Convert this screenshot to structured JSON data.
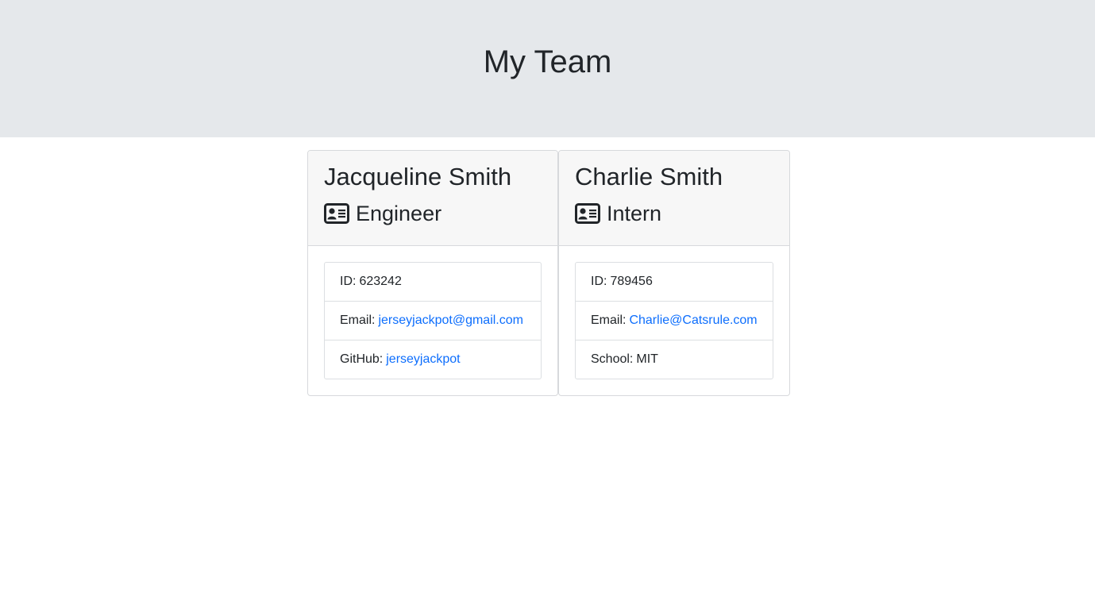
{
  "header": {
    "title": "My Team"
  },
  "employees": [
    {
      "name": "Jacqueline Smith",
      "role": "Engineer",
      "role_icon": "id-card-icon",
      "id_label": "ID:",
      "id": "623242",
      "email_label": "Email:",
      "email": "jerseyjackpot@gmail.com",
      "extra_label": "GitHub:",
      "extra_value": "jerseyjackpot"
    },
    {
      "name": "Charlie Smith",
      "role": "Intern",
      "role_icon": "id-card-icon",
      "id_label": "ID:",
      "id": "789456",
      "email_label": "Email:",
      "email": "Charlie@Catsrule.com",
      "extra_label": "School:",
      "extra_value": "MIT"
    }
  ],
  "colors": {
    "header_bg": "#e5e8eb",
    "card_header_bg": "#f7f7f7",
    "link": "#0d6efd"
  }
}
